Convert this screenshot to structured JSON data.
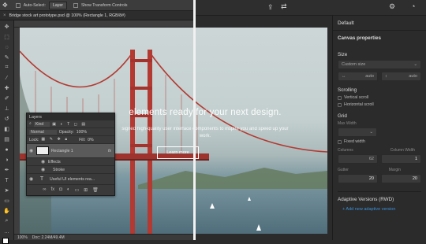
{
  "photoshop": {
    "options": {
      "auto_select_label": "Auto-Select:",
      "auto_select_value": "Layer",
      "transform_label": "Show Transform Controls"
    },
    "document_tab": "Bridge stock art prototype.psd @ 100% (Rectangle 1, RGB/8#)",
    "status": {
      "zoom": "100%",
      "doc": "Doc: 2.24M/49.4M"
    },
    "layers_panel": {
      "title": "Layers",
      "kind_label": "Kind",
      "blend_mode": "Normal",
      "opacity_label": "Opacity:",
      "opacity_value": "100%",
      "lock_label": "Lock:",
      "fill_label": "Fill:",
      "fill_value": "0%",
      "layers": [
        {
          "name": "Rectangle 1",
          "fx": "fx"
        },
        {
          "name": "Effects"
        },
        {
          "name": "Stroke"
        },
        {
          "name": "Useful UI elements rea..."
        }
      ]
    }
  },
  "hero": {
    "headline": "elements ready for your next design.",
    "subline": "signed high-quality user interface components to inspire you and speed up your work.",
    "button": "Learn more"
  },
  "panel": {
    "title": "Default",
    "canvas_properties": "Canvas properties",
    "size_label": "Size",
    "size_value": "Custom size",
    "auto1": "auto",
    "auto2": "auto",
    "scrolling_label": "Scrolling",
    "vertical_scroll": "Vertical scroll",
    "horizontal_scroll": "Horizontal scroll",
    "grid_label": "Grid",
    "max_width_label": "Max Width",
    "fixed_width": "Fixed width",
    "columns_label": "Columns",
    "column_width_label": "Column Width",
    "columns_value": "62",
    "column_width_value": "1",
    "gutter_label": "Gutter",
    "margin_label": "Margin",
    "gutter_value": "20",
    "margin_value": "20",
    "adaptive_label": "Adaptive Versions (RWD)",
    "add_adaptive": "+ Add new adaptive version"
  },
  "colors": {
    "accent_blue": "#3b8fd8",
    "panel_bg": "#2b2b2b",
    "bridge_red": "#b23a32"
  }
}
